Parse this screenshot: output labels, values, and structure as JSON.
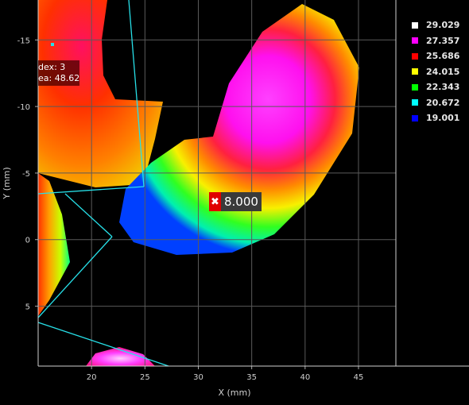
{
  "chart_data": {
    "type": "heatmap",
    "xlabel": "X (mm)",
    "ylabel": "Y (mm)",
    "xlim": [
      15,
      48.5
    ],
    "ylim": [
      -18,
      9.5
    ],
    "y_inverted": true,
    "x_ticks": [
      20,
      25,
      30,
      35,
      40,
      45
    ],
    "y_ticks": [
      -15,
      -10,
      -5,
      0,
      5
    ],
    "grid": true,
    "legend_position": "right",
    "colorscale": [
      {
        "label": "29.029",
        "color": "#ffffff"
      },
      {
        "label": "27.357",
        "color": "#ff00ff"
      },
      {
        "label": "25.686",
        "color": "#ff0000"
      },
      {
        "label": "24.015",
        "color": "#ffff00"
      },
      {
        "label": "22.343",
        "color": "#00ff00"
      },
      {
        "label": "20.672",
        "color": "#00ffff"
      },
      {
        "label": "19.001",
        "color": "#0000ff"
      }
    ],
    "marker": {
      "x": 29,
      "y": -3,
      "value_label": "8.000"
    },
    "info": {
      "index_line": "dex: 3",
      "area_line": "ea: 48.62"
    }
  }
}
